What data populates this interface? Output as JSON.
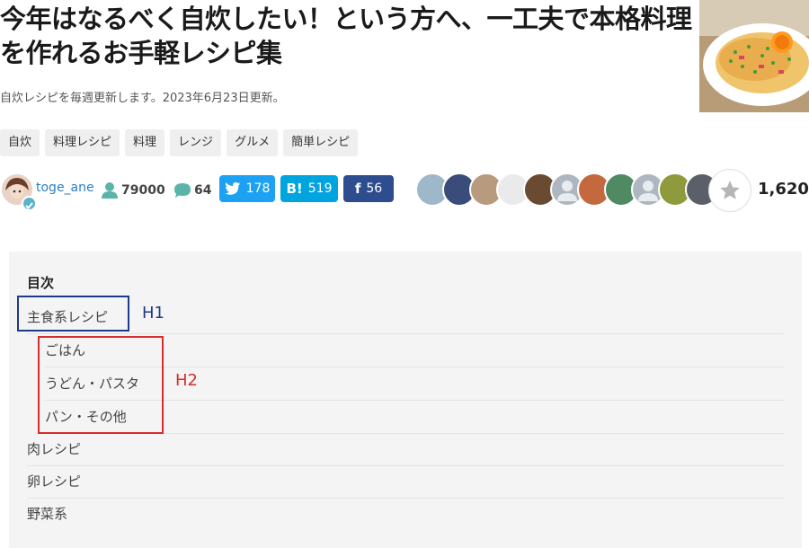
{
  "article": {
    "title": "今年はなるべく自炊したい！という方へ、一工夫で本格料理を作れるお手軽レシピ集",
    "updated": "自炊レシピを毎週更新します。2023年6月23日更新。",
    "thumbnail_icon": "dish-photo"
  },
  "tags": [
    "自炊",
    "料理レシピ",
    "料理",
    "レンジ",
    "グルメ",
    "簡単レシピ"
  ],
  "author": {
    "name": "toge_ane",
    "followers": "79000",
    "comments": "64"
  },
  "share": {
    "twitter": "178",
    "hatena": "519",
    "facebook": "56",
    "hatena_icon": "B!",
    "facebook_icon": "f"
  },
  "likes": {
    "count": "1,620"
  },
  "toc": {
    "title": "目次",
    "items": [
      {
        "label": "主食系レシピ",
        "level": 1
      },
      {
        "label": "ごはん",
        "level": 2
      },
      {
        "label": "うどん・パスタ",
        "level": 2
      },
      {
        "label": "パン・その他",
        "level": 2
      },
      {
        "label": "肉レシピ",
        "level": 1
      },
      {
        "label": "卵レシピ",
        "level": 1
      },
      {
        "label": "野菜系",
        "level": 1
      }
    ]
  },
  "annotations": {
    "h1": "H1",
    "h2": "H2",
    "h1_color": "#1f3a8a",
    "h2_color": "#d62d2d"
  }
}
